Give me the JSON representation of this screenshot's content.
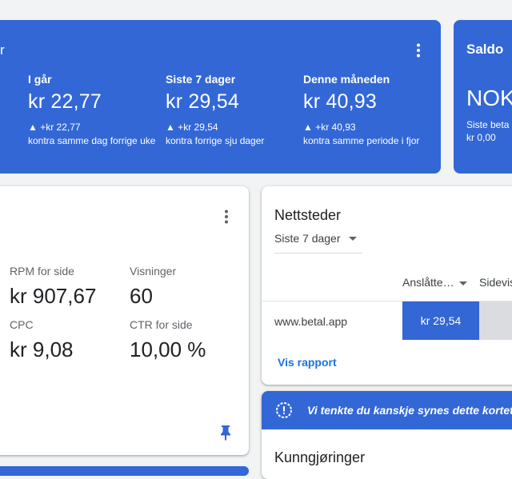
{
  "earnings": {
    "title_fragment": "r",
    "stats": [
      {
        "label": "I går",
        "value": "kr 22,77",
        "delta": "▲ +kr 22,77",
        "compare": "kontra samme dag forrige uke"
      },
      {
        "label": "Siste 7 dager",
        "value": "kr 29,54",
        "delta": "▲ +kr 29,54",
        "compare": "kontra forrige sju dager"
      },
      {
        "label": "Denne måneden",
        "value": "kr 40,93",
        "delta": "▲ +kr 40,93",
        "compare": "kontra samme periode i fjor"
      }
    ]
  },
  "saldo": {
    "title": "Saldo",
    "amount": "NOK",
    "sub1": "Siste beta",
    "sub2": "kr 0,00"
  },
  "metrics": {
    "items": [
      {
        "label": "RPM for side",
        "value": "kr 907,67"
      },
      {
        "label": "Visninger",
        "value": "60"
      },
      {
        "label": "CPC",
        "value": "kr 9,08"
      },
      {
        "label": "CTR for side",
        "value": "10,00 %"
      }
    ]
  },
  "sites": {
    "title": "Nettsteder",
    "period": "Siste 7 dager",
    "col1": "Anslåtte…",
    "col2": "Sidevis",
    "row": {
      "site": "www.betal.app",
      "value": "kr 29,54"
    },
    "link": "Vis rapport"
  },
  "tip": {
    "text": "Vi tenkte du kanskje synes dette kortet e"
  },
  "announcements": {
    "title": "Kunngjøringer"
  },
  "colors": {
    "primary_blue": "#3367d6",
    "link_blue": "#1a73e8"
  },
  "icons": [
    "more-vert-icon",
    "pin-icon",
    "lightbulb-settings-icon",
    "dropdown-caret-icon"
  ]
}
